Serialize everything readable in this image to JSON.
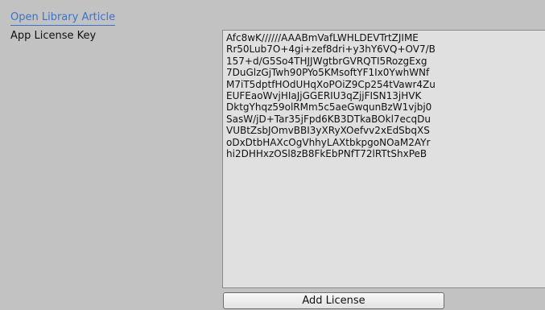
{
  "article_link": "Open Library Article",
  "license": {
    "label": "App License Key",
    "key_value": "Afc8wK//////AAABmVafLWHLDEVTrtZJIME\nRr50Lub7O+4gi+zef8dri+y3hY6VQ+OV7/B\n157+d/G5So4THJJWgtbrGVRQTI5RozgExg\n7DuGlzGjTwh90PYo5KMsoftYF1Ix0YwhWNf\nM7iT5dptfHOdUHqXoPOiZ9Cp254tVawr4Zu\nEUFEaoWvjHIaJjGGERIU3qZjjFISN13jHVK\nDktgYhqz59olRMm5c5aeGwqunBzW1vjbj0\nSasW/jD+Tar35jFpd6KB3DTkaBOkl7ecqDu\nVUBtZsbJOmvBBI3yXRyXOefvv2xEdSbqXS\noDxDtbHAXcOgVhhyLAXtbkpgoNOaM2AYr\nhi2DHHxzOSl8zB8FkEbPNfT72lRTtShxPeB",
    "add_button_label": "Add License"
  }
}
